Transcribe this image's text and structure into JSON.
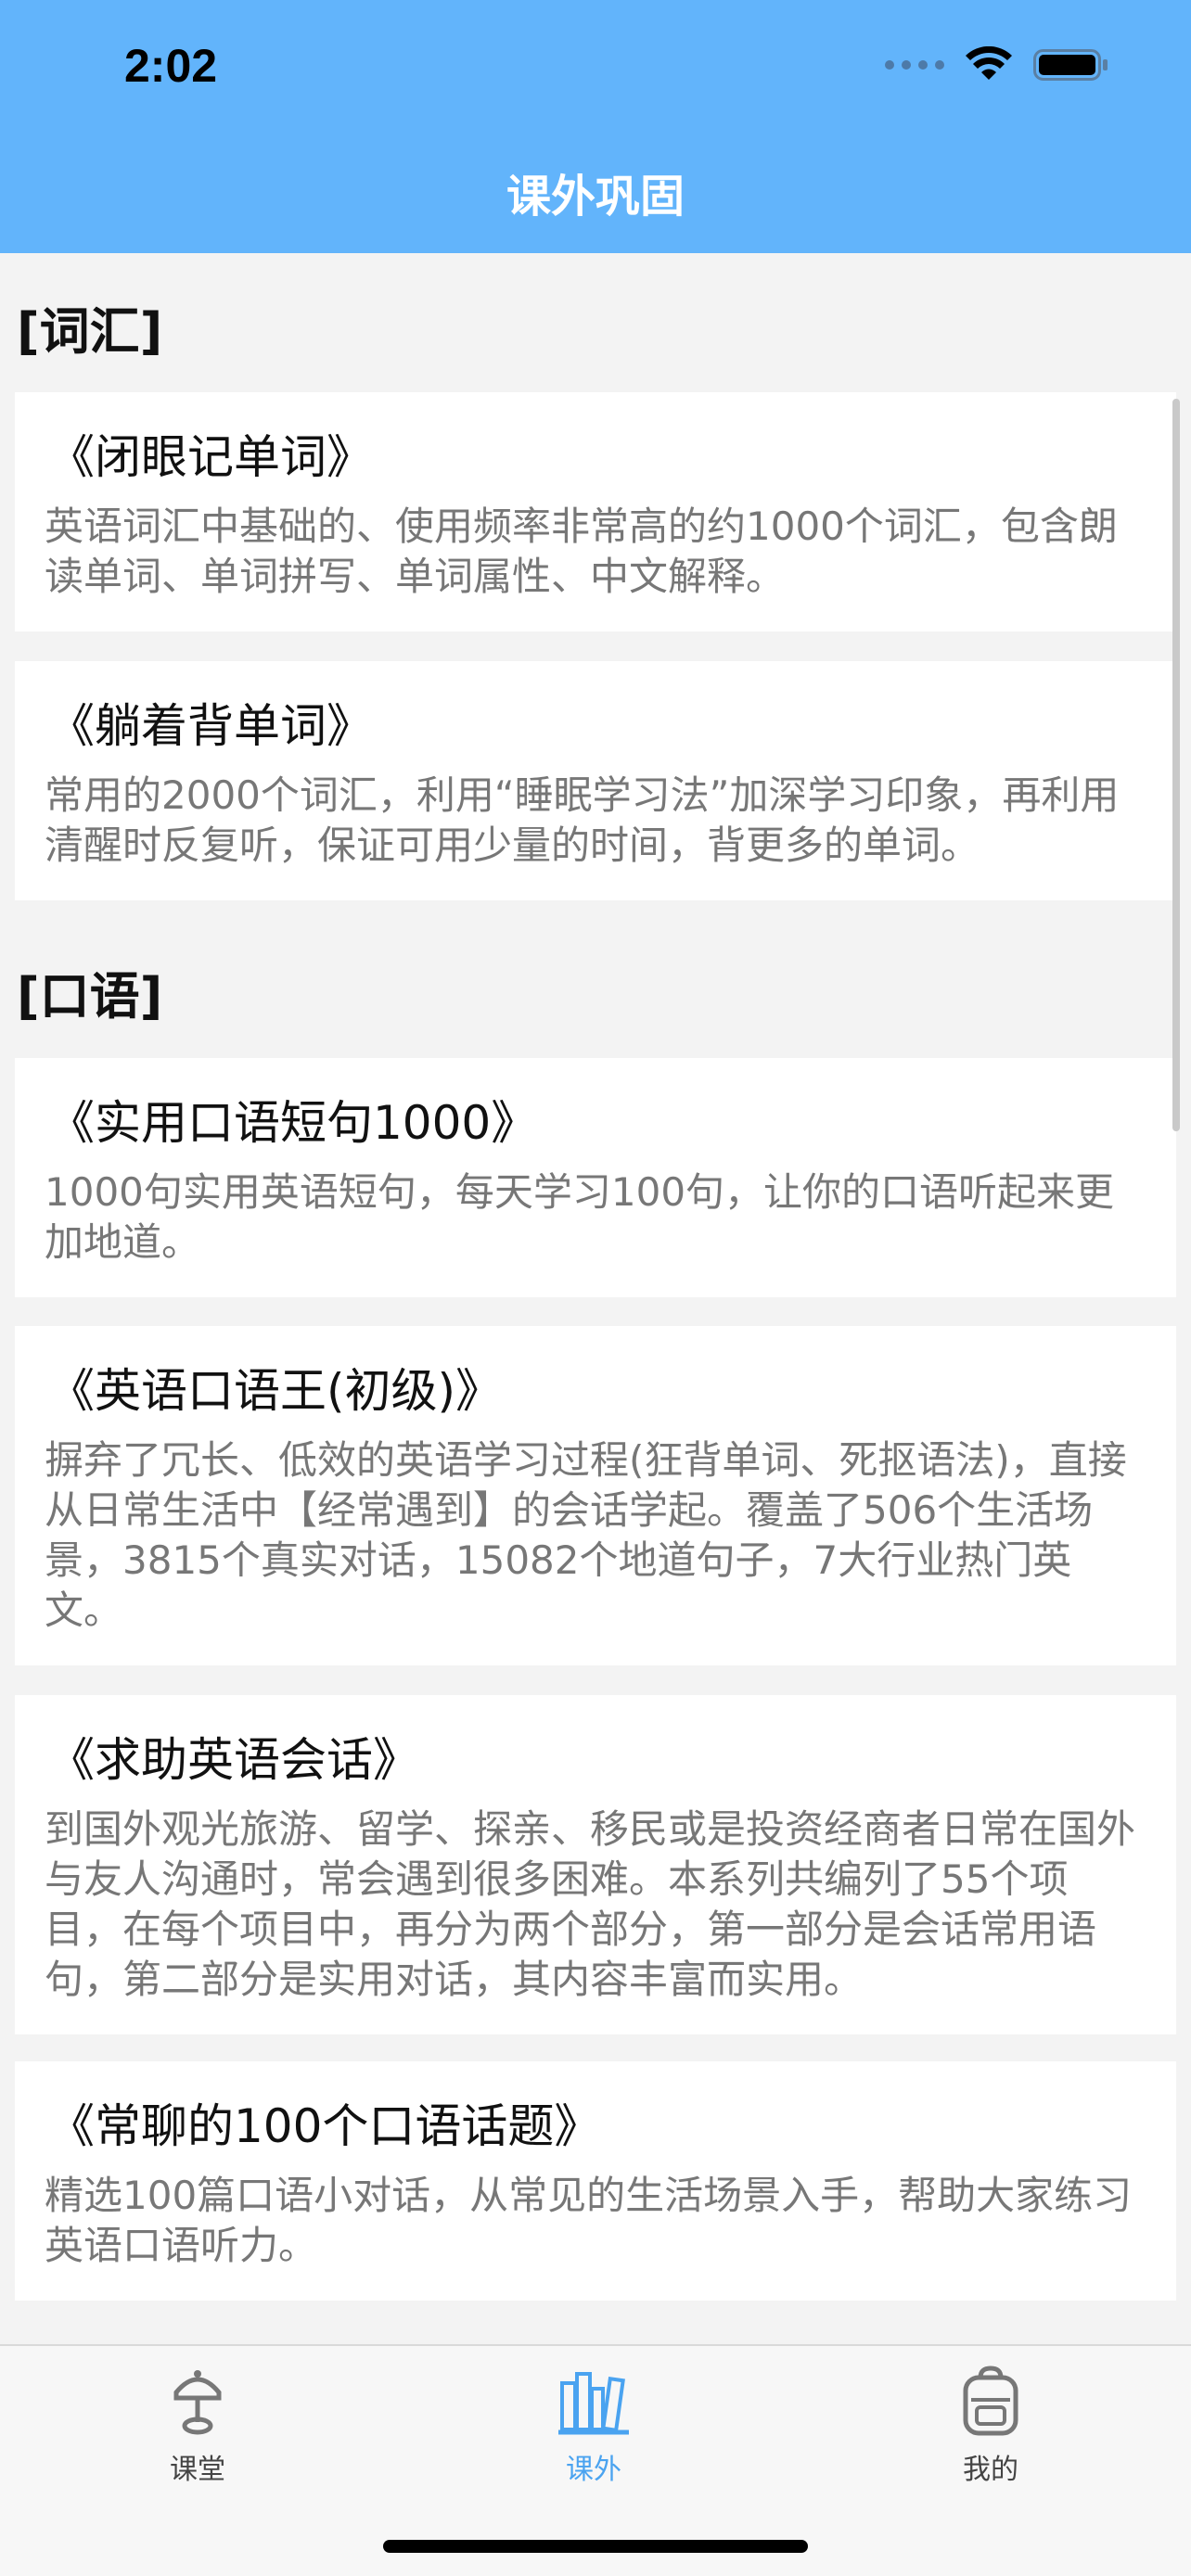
{
  "status_bar": {
    "time": "2:02"
  },
  "nav": {
    "title": "课外巩固"
  },
  "sections": [
    {
      "title": "[词汇]",
      "items": [
        {
          "title": "《闭眼记单词》",
          "desc": "英语词汇中基础的、使用频率非常高的约1000个词汇，包含朗读单词、单词拼写、单词属性、中文解释。"
        },
        {
          "title": "《躺着背单词》",
          "desc": "常用的2000个词汇，利用“睡眠学习法”加深学习印象，再利用清醒时反复听，保证可用少量的时间，背更多的单词。"
        }
      ]
    },
    {
      "title": "[口语]",
      "items": [
        {
          "title": "《实用口语短句1000》",
          "desc": "1000句实用英语短句，每天学习100句，让你的口语听起来更加地道。"
        },
        {
          "title": "《英语口语王(初级)》",
          "desc": "摒弃了冗长、低效的英语学习过程(狂背单词、死抠语法)，直接从日常生活中【经常遇到】的会话学起。覆盖了506个生活场景，3815个真实对话，15082个地道句子，7大行业热门英文。"
        },
        {
          "title": "《求助英语会话》",
          "desc": "到国外观光旅游、留学、探亲、移民或是投资经商者日常在国外与友人沟通时，常会遇到很多困难。本系列共编列了55个项目，在每个项目中，再分为两个部分，第一部分是会话常用语句，第二部分是实用对话，其内容丰富而实用。"
        },
        {
          "title": "《常聊的100个口语话题》",
          "desc": "精选100篇口语小对话，从常见的生活场景入手，帮助大家练习英语口语听力。"
        }
      ]
    }
  ],
  "tabbar": {
    "tabs": [
      {
        "label": "课堂",
        "icon": "lamp-icon",
        "active": false
      },
      {
        "label": "课外",
        "icon": "books-icon",
        "active": true
      },
      {
        "label": "我的",
        "icon": "backpack-icon",
        "active": false
      }
    ]
  },
  "colors": {
    "accent": "#62b4fb",
    "active_tab": "#4aa3f0",
    "background": "#f3f3f3"
  }
}
